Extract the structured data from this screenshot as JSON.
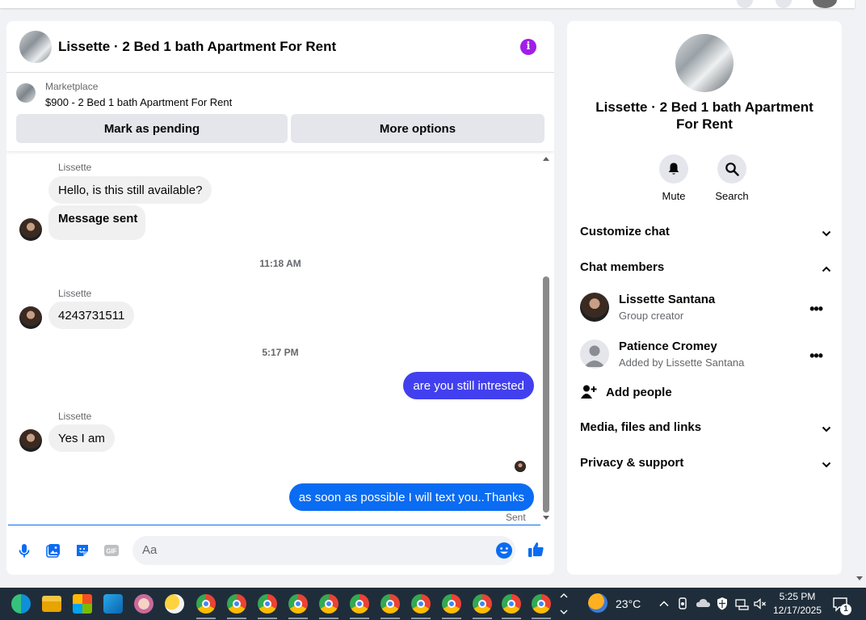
{
  "conversation": {
    "title": "Lissette · 2 Bed 1 bath Apartment For Rent",
    "info_icon": "i"
  },
  "marketplace": {
    "label": "Marketplace",
    "listing": "$900 - 2 Bed 1 bath Apartment For Rent",
    "mark_pending": "Mark as pending",
    "more_options": "More options"
  },
  "messages": {
    "m1_sender": "Lissette",
    "m1_text": "Hello, is this still available?",
    "m2_text": "Message sent",
    "ts1": "11:18 AM",
    "m3_sender": "Lissette",
    "m3_text": "4243731511",
    "ts2": "5:17 PM",
    "m4_text": "are you still intrested",
    "m5_sender": "Lissette",
    "m5_text": "Yes I am",
    "m6_text": "as soon as possible I will text you..Thanks",
    "status": "Sent"
  },
  "composer": {
    "placeholder": "Aa"
  },
  "info_panel": {
    "title": "Lissette · 2 Bed 1 bath Apartment For Rent",
    "mute": "Mute",
    "search": "Search",
    "customize": "Customize chat",
    "members_header": "Chat members",
    "members": [
      {
        "name": "Lissette Santana",
        "role": "Group creator"
      },
      {
        "name": "Patience Cromey",
        "role": "Added by Lissette Santana"
      }
    ],
    "add_people": "Add people",
    "media": "Media, files and links",
    "privacy": "Privacy & support"
  },
  "taskbar": {
    "weather": "23°C",
    "time": "5:25 PM",
    "date": "12/17/2025",
    "notif_count": "1"
  },
  "colors": {
    "accent": "#0a6cf2",
    "sent_violet": "#4240ee",
    "info_purple": "#a11ee8"
  }
}
